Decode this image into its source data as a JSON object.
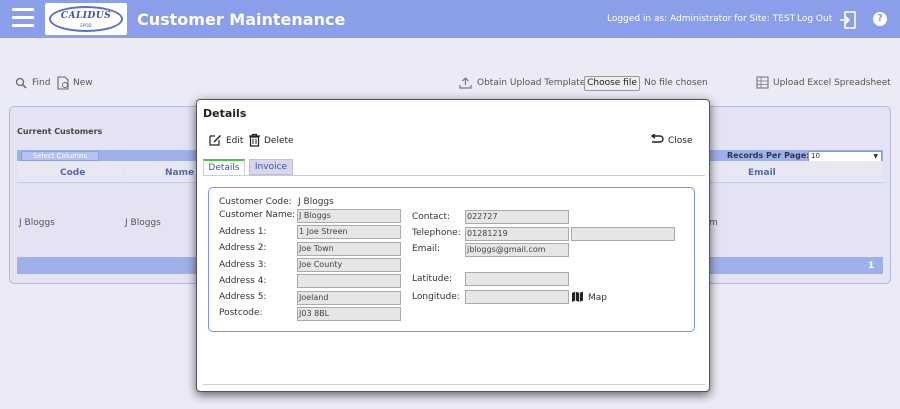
{
  "header": {
    "logo_text": "CALIDUS",
    "logo_subtext": "EPOD",
    "title": "Customer Maintenance",
    "logged_in": "Logged in as: Administrator for Site: TEST",
    "logout_label": "Log Out",
    "help_label": "?"
  },
  "toolbar": {
    "find_label": "Find",
    "new_label": "New",
    "obtain_template_label": "Obtain Upload Template",
    "choose_file_label": "Choose file",
    "no_file_label": "No file chosen",
    "upload_excel_label": "Upload Excel Spreadsheet"
  },
  "grid": {
    "title": "Current Customers",
    "select_columns_label": "Select Columns",
    "records_per_page_label": "Records Per Page:",
    "records_per_page_value": "10",
    "columns": [
      "Code",
      "Name",
      "Email"
    ],
    "rows": [
      {
        "code": "J Bloggs",
        "name": "J Bloggs",
        "email_fragment": "m"
      }
    ],
    "page_number": "1"
  },
  "modal": {
    "title": "Details",
    "edit_label": "Edit",
    "delete_label": "Delete",
    "close_label": "Close",
    "tabs": [
      "Details",
      "Invoice"
    ],
    "form": {
      "customer_code_label": "Customer Code:",
      "customer_code_value": "J Bloggs",
      "customer_name_label": "Customer Name:",
      "customer_name_value": "J Bloggs",
      "address1_label": "Address 1:",
      "address1_value": "1 Joe Streen",
      "address2_label": "Address 2:",
      "address2_value": "Joe Town",
      "address3_label": "Address 3:",
      "address3_value": "Joe County",
      "address4_label": "Address 4:",
      "address4_value": "",
      "address5_label": "Address 5:",
      "address5_value": "Joeland",
      "postcode_label": "Postcode:",
      "postcode_value": "J03 8BL",
      "contact_label": "Contact:",
      "contact_value": "022727",
      "telephone_label": "Telephone:",
      "telephone_value": "01281219",
      "telephone2_value": "",
      "email_label": "Email:",
      "email_value": "jbloggs@gmail.com",
      "latitude_label": "Latitude:",
      "latitude_value": "",
      "longitude_label": "Longitude:",
      "longitude_value": "",
      "map_label": "Map"
    }
  },
  "icons": {
    "menu": "hamburger-menu-icon",
    "logout": "logout-door-icon",
    "help": "help-circle-icon",
    "find": "search-icon",
    "new": "new-document-icon",
    "obtain": "upload-icon",
    "excel": "excel-upload-icon",
    "edit": "edit-icon",
    "delete": "trash-icon",
    "close": "undo-arrow-icon",
    "map": "map-icon"
  },
  "colors": {
    "header_bg": "#8a9ee9",
    "page_bg": "#ebebf7",
    "accent": "#3354b7",
    "tab_active_border": "#49c24a"
  }
}
